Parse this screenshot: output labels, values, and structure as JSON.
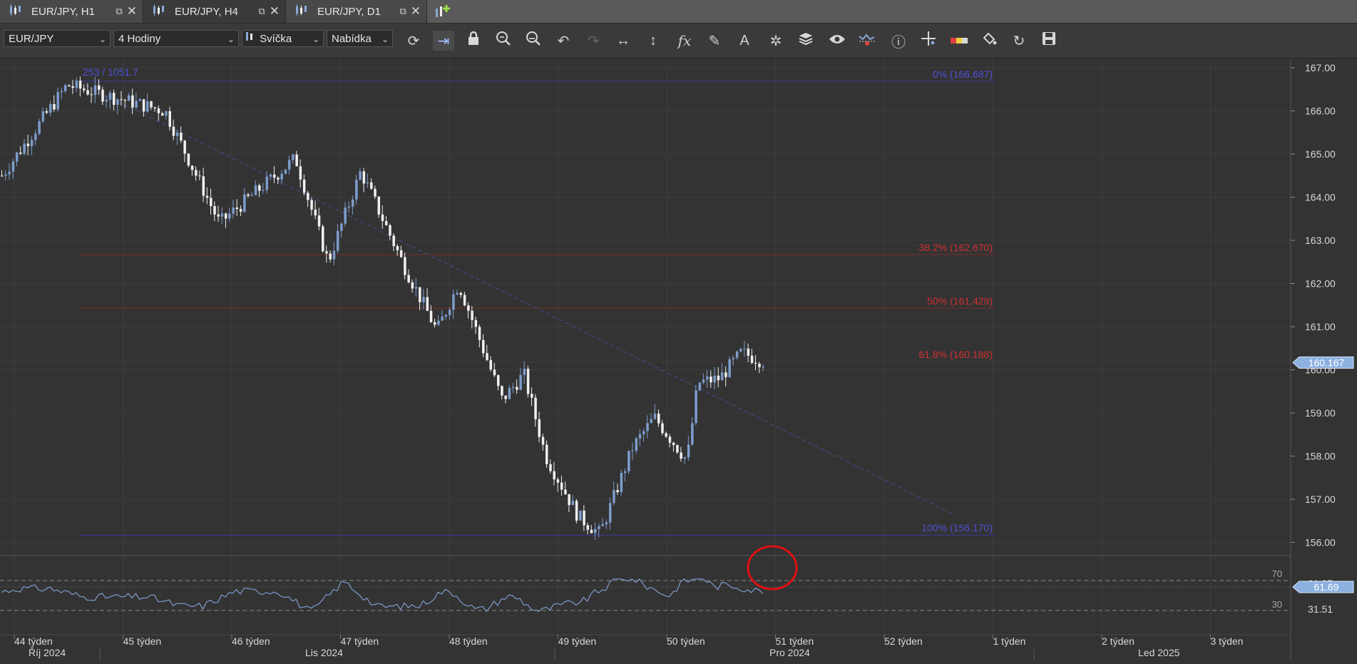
{
  "tabs": [
    {
      "label": "EUR/JPY, H1",
      "active": false
    },
    {
      "label": "EUR/JPY, H4",
      "active": true
    },
    {
      "label": "EUR/JPY, D1",
      "active": false
    }
  ],
  "toolbar": {
    "symbol": "EUR/JPY",
    "timeframe": "4 Hodiny",
    "chart_type": "Svíčka",
    "price_side": "Nabídka",
    "buttons": [
      "refresh-icon",
      "shift-chart-icon",
      "lock-icon",
      "zoom-in-icon",
      "zoom-out-icon",
      "undo-icon",
      "redo-icon",
      "fit-horizontal-icon",
      "fit-vertical-icon",
      "indicators-fx-icon",
      "pencil-draw-icon",
      "text-tool-icon",
      "pattern-tool-icon",
      "layers-icon",
      "visibility-eye-icon",
      "alerts-icon",
      "info-icon",
      "crosshair-icon",
      "color-theme-icon",
      "paint-bucket-icon",
      "fit-chart-icon",
      "save-icon"
    ]
  },
  "colors": {
    "background": "#333333",
    "bull_candle": "#7d9ccc",
    "bear_candle": "#f0f0f0",
    "fib_blue": "#5050d8",
    "fib_red": "#d03030",
    "current_price_tag": "#8cb0e0",
    "annotation_circle": "#e01010"
  },
  "chart": {
    "measurement_label": "253 / 1051.7",
    "current_price": "160.167",
    "fib_levels": [
      {
        "label": "0% (166.687)",
        "value": 166.687,
        "color": "blue"
      },
      {
        "label": "38.2% (162.670)",
        "value": 162.67,
        "color": "red"
      },
      {
        "label": "50% (161.429)",
        "value": 161.429,
        "color": "red"
      },
      {
        "label": "61.8% (160.188)",
        "value": 160.188,
        "color": "red"
      },
      {
        "label": "100% (156.170)",
        "value": 156.17,
        "color": "blue"
      }
    ],
    "price_ticks": [
      "167.00",
      "166.00",
      "165.00",
      "164.00",
      "163.00",
      "162.00",
      "161.00",
      "160.00",
      "159.00",
      "158.00",
      "157.00",
      "156.00"
    ],
    "week_labels": [
      "44 týden",
      "45 týden",
      "46 týden",
      "47 týden",
      "48 týden",
      "49 týden",
      "50 týden",
      "51 týden",
      "52 týden",
      "1 týden",
      "2 týden",
      "3 týden"
    ],
    "month_labels": [
      "Říj 2024",
      "Lis 2024",
      "Pro 2024",
      "Led 2025"
    ]
  },
  "rsi": {
    "value": "61.69",
    "upper_level": "70",
    "lower_level": "30",
    "ticks": [
      "61.07",
      "31.51"
    ]
  },
  "chart_data": {
    "type": "line",
    "price_ylim": [
      155.7,
      167.2
    ],
    "keypoints": [
      {
        "week": 44.0,
        "price": 164.5
      },
      {
        "week": 44.6,
        "price": 166.6
      },
      {
        "week": 45.5,
        "price": 166.0
      },
      {
        "week": 46.0,
        "price": 163.4
      },
      {
        "week": 46.7,
        "price": 164.9
      },
      {
        "week": 47.0,
        "price": 162.5
      },
      {
        "week": 47.3,
        "price": 164.6
      },
      {
        "week": 47.7,
        "price": 162.4
      },
      {
        "week": 48.0,
        "price": 160.9
      },
      {
        "week": 48.2,
        "price": 162.0
      },
      {
        "week": 48.6,
        "price": 159.3
      },
      {
        "week": 48.8,
        "price": 159.9
      },
      {
        "week": 49.0,
        "price": 158.0
      },
      {
        "week": 49.3,
        "price": 156.6
      },
      {
        "week": 49.5,
        "price": 156.2
      },
      {
        "week": 49.8,
        "price": 158.2
      },
      {
        "week": 50.0,
        "price": 158.9
      },
      {
        "week": 50.3,
        "price": 157.9
      },
      {
        "week": 50.4,
        "price": 159.7
      },
      {
        "week": 50.6,
        "price": 159.8
      },
      {
        "week": 50.8,
        "price": 160.4
      },
      {
        "week": 51.0,
        "price": 160.2
      }
    ]
  }
}
